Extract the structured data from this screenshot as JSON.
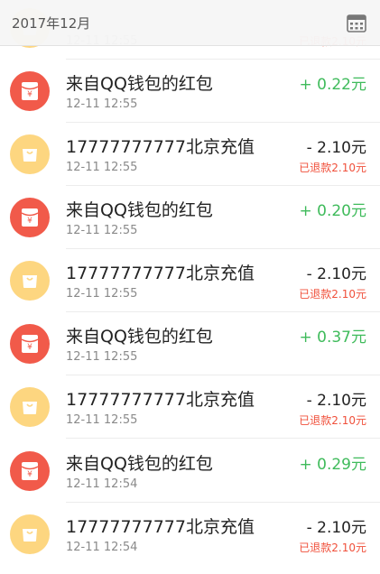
{
  "header": {
    "month": "2017年12月",
    "calendar_icon": "calendar-icon"
  },
  "partial_row": {
    "time": "12-11 12:55",
    "note": "已退款2.10元"
  },
  "transactions": [
    {
      "type": "red-packet",
      "icon": "red-packet-icon",
      "title": "来自QQ钱包的红包",
      "time": "12-11 12:55",
      "amount": "+ 0.22元",
      "note": ""
    },
    {
      "type": "recharge",
      "icon": "shopping-bag-icon",
      "title": "17777777777北京充值",
      "time": "12-11 12:55",
      "amount": "- 2.10元",
      "note": "已退款2.10元"
    },
    {
      "type": "red-packet",
      "icon": "red-packet-icon",
      "title": "来自QQ钱包的红包",
      "time": "12-11 12:55",
      "amount": "+ 0.20元",
      "note": ""
    },
    {
      "type": "recharge",
      "icon": "shopping-bag-icon",
      "title": "17777777777北京充值",
      "time": "12-11 12:55",
      "amount": "- 2.10元",
      "note": "已退款2.10元"
    },
    {
      "type": "red-packet",
      "icon": "red-packet-icon",
      "title": "来自QQ钱包的红包",
      "time": "12-11 12:55",
      "amount": "+ 0.37元",
      "note": ""
    },
    {
      "type": "recharge",
      "icon": "shopping-bag-icon",
      "title": "17777777777北京充值",
      "time": "12-11 12:55",
      "amount": "- 2.10元",
      "note": "已退款2.10元"
    },
    {
      "type": "red-packet",
      "icon": "red-packet-icon",
      "title": "来自QQ钱包的红包",
      "time": "12-11 12:54",
      "amount": "+ 0.29元",
      "note": ""
    },
    {
      "type": "recharge",
      "icon": "shopping-bag-icon",
      "title": "17777777777北京充值",
      "time": "12-11 12:54",
      "amount": "- 2.10元",
      "note": "已退款2.10元"
    }
  ],
  "colors": {
    "income": "#3fbb5b",
    "refund": "#f0503b",
    "red_icon": "#f15a4a",
    "yellow_icon": "#fdd680"
  }
}
